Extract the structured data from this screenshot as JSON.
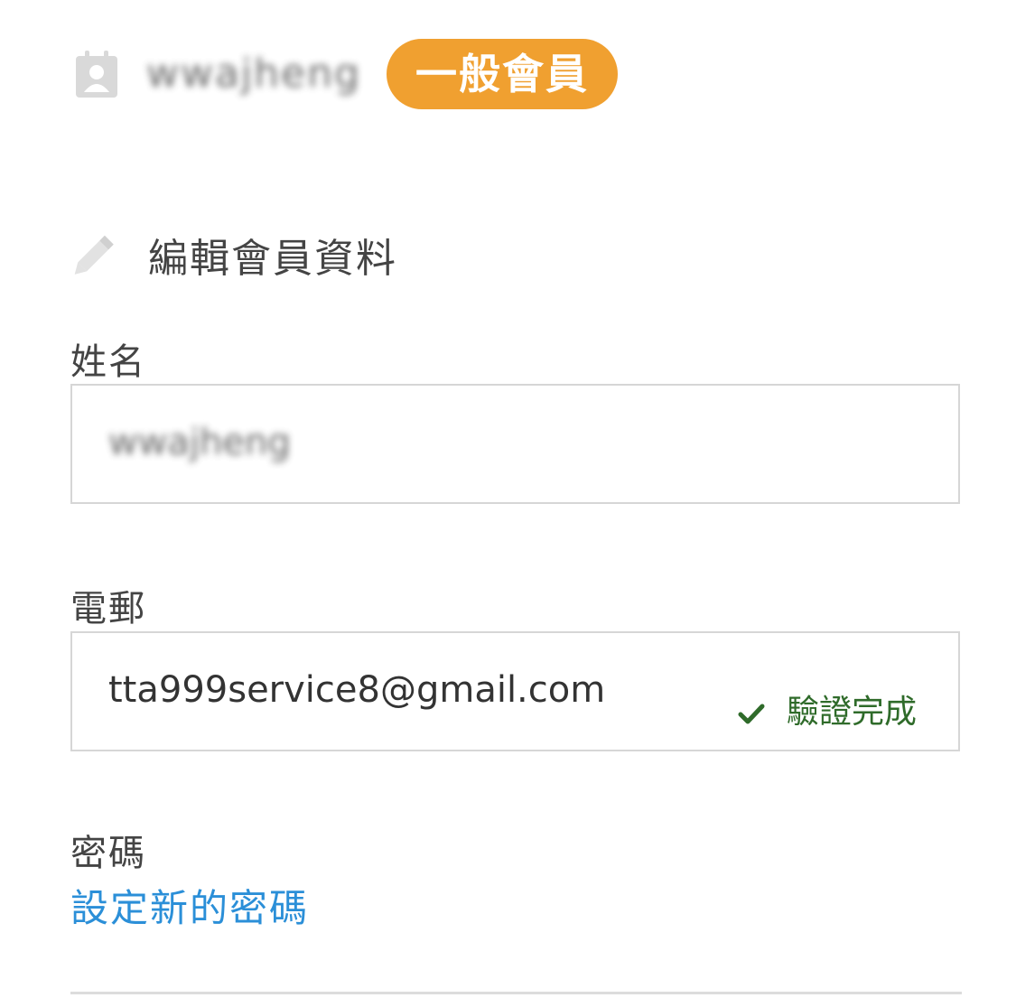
{
  "header": {
    "username": "wwajheng",
    "member_level": "一般會員"
  },
  "edit_section": {
    "title": "編輯會員資料"
  },
  "fields": {
    "name": {
      "label": "姓名",
      "value": "wwajheng"
    },
    "email": {
      "label": "電郵",
      "value": "tta999service8@gmail.com",
      "status": "驗證完成"
    },
    "password": {
      "label": "密碼",
      "link": "設定新的密碼"
    }
  },
  "colors": {
    "badge": "#f0a030",
    "link": "#2b8fd8",
    "verified": "#2f6b2a",
    "border": "#d6d6d6"
  }
}
